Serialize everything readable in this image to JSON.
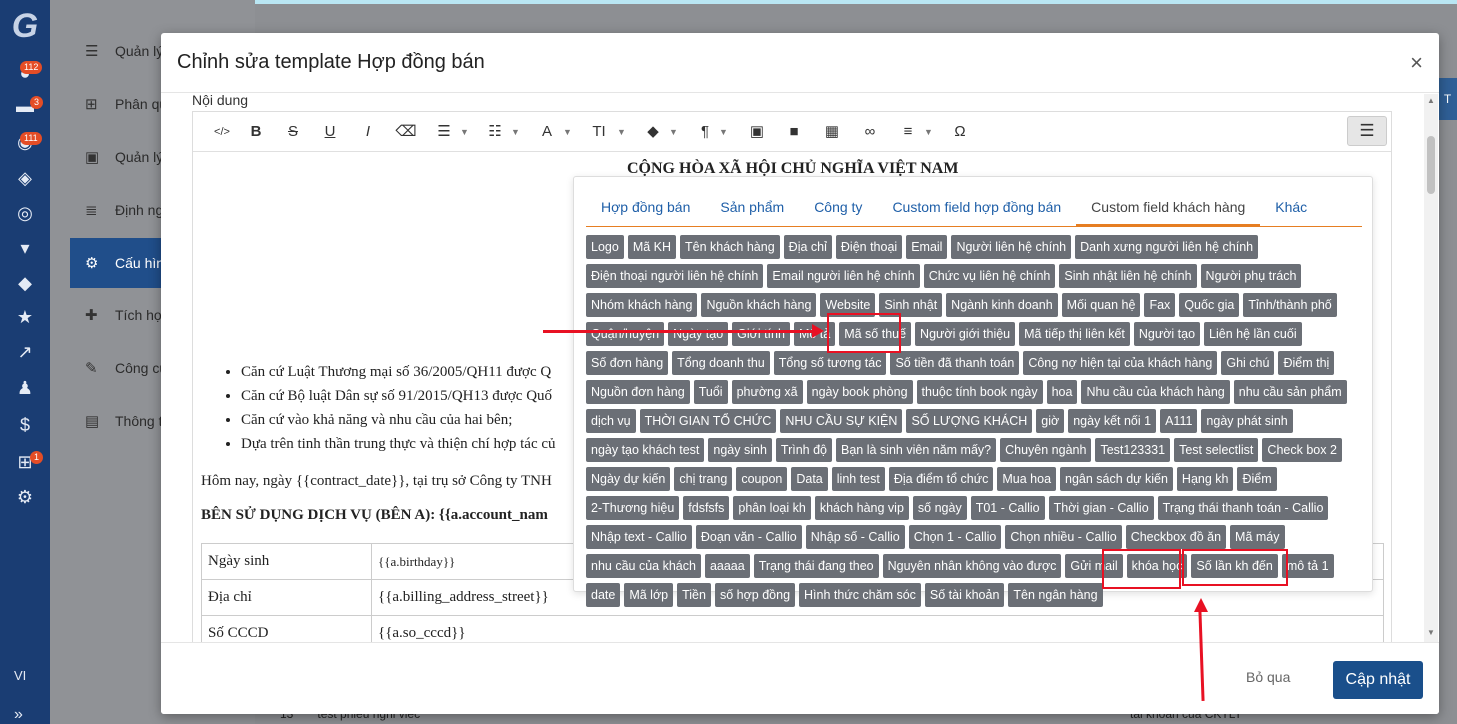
{
  "background": {
    "badges": [
      "112",
      "3",
      "111",
      "1"
    ],
    "language": "VI",
    "side_menu": [
      "Quản lý",
      "Phân qu",
      "Quản lý",
      "Định ng",
      "Cấu hìn",
      "Tích hợp",
      "Công cụ",
      "Thông t"
    ],
    "bottom_row": {
      "index": "13",
      "text": "test phieu nghi viec",
      "right": "tai khoan cua CKTLT"
    },
    "right_tab": "T"
  },
  "modal": {
    "title": "Chỉnh sửa template Hợp đồng bán",
    "close_label": "×",
    "field_label": "Nội dung",
    "footer": {
      "skip_label": "Bỏ qua",
      "update_label": "Cập nhật"
    }
  },
  "toolbar": {
    "items": [
      {
        "icon": "code-icon",
        "glyph": "</>"
      },
      {
        "icon": "bold-icon",
        "glyph": "B"
      },
      {
        "icon": "strikethrough-icon",
        "glyph": "S"
      },
      {
        "icon": "underline-icon",
        "glyph": "U"
      },
      {
        "icon": "italic-icon",
        "glyph": "I"
      },
      {
        "icon": "eraser-icon",
        "glyph": "⌫"
      },
      {
        "icon": "bullet-list-icon",
        "glyph": "☰"
      },
      {
        "icon": "numbered-list-icon",
        "glyph": "☷"
      },
      {
        "icon": "text-color-icon",
        "glyph": "A"
      },
      {
        "icon": "font-size-icon",
        "glyph": "TI"
      },
      {
        "icon": "fill-color-icon",
        "glyph": "◆"
      },
      {
        "icon": "paragraph-icon",
        "glyph": "¶"
      },
      {
        "icon": "image-icon",
        "glyph": "▣"
      },
      {
        "icon": "video-icon",
        "glyph": "■"
      },
      {
        "icon": "table-icon",
        "glyph": "▦"
      },
      {
        "icon": "link-icon",
        "glyph": "∞"
      },
      {
        "icon": "align-icon",
        "glyph": "≡"
      },
      {
        "icon": "omega-icon",
        "glyph": "Ω"
      }
    ],
    "right_icon": "☰"
  },
  "document": {
    "heading": "CỘNG HÒA XÃ HỘI CHỦ NGHĨA VIỆT NAM",
    "list": [
      "Căn cứ Luật Thương mại số 36/2005/QH11 được Q",
      "Căn cứ Bộ luật Dân sự số 91/2015/QH13 được Quố",
      "Căn cứ vào khả năng và nhu cầu của hai bên;",
      "Dựa trên tinh thần trung thực và thiện chí hợp tác củ"
    ],
    "paragraph": "Hôm nay, ngày {{contract_date}}, tại trụ sở Công ty TNH",
    "party_a": "BÊN SỬ DỤNG DỊCH VỤ (BÊN A): {{a.account_nam",
    "table": [
      {
        "label": "Ngày sinh",
        "value": "{{a.birthday}}"
      },
      {
        "label": "Địa chỉ",
        "value": "{{a.billing_address_street}}"
      },
      {
        "label": "Số CCCD",
        "value": "{{a.so_cccd}}"
      }
    ]
  },
  "popover": {
    "tabs": [
      "Hợp đồng bán",
      "Sản phẩm",
      "Công ty",
      "Custom field hợp đồng bán",
      "Custom field khách hàng",
      "Khác"
    ],
    "active_tab": 4,
    "tags": [
      "Logo",
      "Mã KH",
      "Tên khách hàng",
      "Địa chỉ",
      "Điện thoại",
      "Email",
      "Người liên hệ chính",
      "Danh xưng người liên hệ chính",
      "Điện thoại người liên hệ chính",
      "Email người liên hệ chính",
      "Chức vụ liên hệ chính",
      "Sinh nhật liên hệ chính",
      "Người phụ trách",
      "Nhóm khách hàng",
      "Nguồn khách hàng",
      "Website",
      "Sinh nhật",
      "Ngành kinh doanh",
      "Mối quan hệ",
      "Fax",
      "Quốc gia",
      "Tỉnh/thành phố",
      "Quận/huyện",
      "Ngày tạo",
      "Giới tính",
      "Mô tả",
      "Mã số thuế",
      "Người giới thiệu",
      "Mã tiếp thị liên kết",
      "Người tạo",
      "Liên hệ lần cuối",
      "Số đơn hàng",
      "Tổng doanh thu",
      "Tổng số tương tác",
      "Số tiền đã thanh toán",
      "Công nợ hiện tại của khách hàng",
      "Ghi chú",
      "Điểm thị",
      "Nguồn đơn hàng",
      "Tuổi",
      "phường xã",
      "ngày book phòng",
      "thuộc tính book ngày",
      "hoa",
      "Nhu cầu của khách hàng",
      "nhu cầu sản phẩm",
      "dịch vụ",
      "THỜI GIAN TỔ CHỨC",
      "NHU CẦU SỰ KIỆN",
      "SỐ LƯỢNG KHÁCH",
      "giờ",
      "ngày kết nối 1",
      "A111",
      "ngày phát sinh",
      "ngày tạo khách test",
      "ngày sinh",
      "Trình độ",
      "Bạn là sinh viên năm mấy?",
      "Chuyên ngành",
      "Test123331",
      "Test selectlist",
      "Check box 2",
      "Ngày dự kiến",
      "chị trang",
      "coupon",
      "Data",
      "linh test",
      "Địa điểm tổ chức",
      "Mua hoa",
      "ngân sách dự kiến",
      "Hạng kh",
      "Điểm",
      "2-Thương hiệu",
      "fdsfsfs",
      "phân loại kh",
      "khách hàng vip",
      "số ngày",
      "T01 - Callio",
      "Thời gian - Callio",
      "Trạng thái thanh toán - Callio",
      "Nhập text - Callio",
      "Đoạn văn - Callio",
      "Nhập số - Callio",
      "Chọn 1 - Callio",
      "Chọn nhiều - Callio",
      "Checkbox đồ ăn",
      "Mã máy",
      "nhu cầu của khách",
      "aaaaa",
      "Trạng thái đang theo",
      "Nguyên nhân không vào được",
      "Gửi mail",
      "khóa học",
      "Số lần kh đến",
      "mô tả 1",
      "date",
      "Mã lớp",
      "Tiền",
      "số hợp đồng",
      "Hình thức chăm sóc",
      "Số tài khoản",
      "Tên ngân hàng"
    ]
  },
  "colors": {
    "highlight": "#e81123",
    "accent": "#e67e22",
    "primary": "#1a4f8b",
    "tag": "#6b6f76"
  }
}
